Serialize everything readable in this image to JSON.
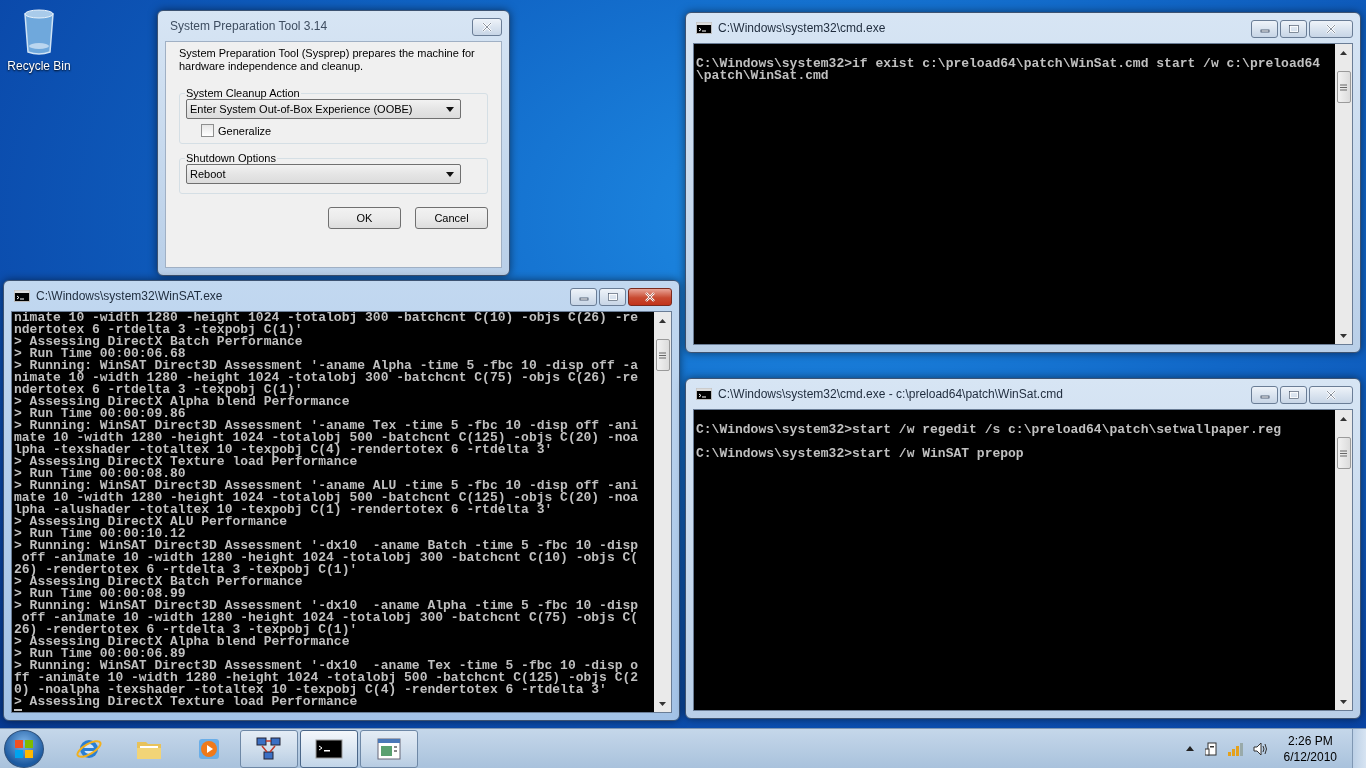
{
  "desktop": {
    "icons": [
      {
        "label": "Recycle Bin"
      }
    ]
  },
  "windows": [
    {
      "kind": "dialog",
      "title": "System Preparation Tool 3.14",
      "active": false,
      "description": "System Preparation Tool (Sysprep) prepares the machine for hardware independence and cleanup.",
      "groups": [
        {
          "label": "System Cleanup Action",
          "value": "Enter System Out-of-Box Experience (OOBE)",
          "checkbox": {
            "label": "Generalize",
            "checked": false
          }
        },
        {
          "label": "Shutdown Options",
          "value": "Reboot"
        }
      ],
      "buttons": [
        "OK",
        "Cancel"
      ]
    },
    {
      "kind": "console",
      "title": "C:\\Windows\\system32\\cmd.exe",
      "active": false,
      "cursor": false,
      "blocks": [
        [
          "C:\\Windows\\system32>if exist c:\\preload64\\patch\\WinSat.cmd start /w c:\\preload64",
          "\\patch\\WinSat.cmd"
        ]
      ]
    },
    {
      "kind": "console",
      "title": "C:\\Windows\\system32\\WinSAT.exe",
      "active": true,
      "cursor": true,
      "blocks": [
        [
          "nimate 10 -width 1280 -height 1024 -totalobj 300 -batchcnt C(10) -objs C(26) -re",
          "ndertotex 6 -rtdelta 3 -texpobj C(1)'",
          "> Assessing DirectX Batch Performance",
          "> Run Time 00:00:06.68",
          "> Running: WinSAT Direct3D Assessment '-aname Alpha -time 5 -fbc 10 -disp off -a",
          "nimate 10 -width 1280 -height 1024 -totalobj 300 -batchcnt C(75) -objs C(26) -re",
          "ndertotex 6 -rtdelta 3 -texpobj C(1)'",
          "> Assessing DirectX Alpha blend Performance",
          "> Run Time 00:00:09.86",
          "> Running: WinSAT Direct3D Assessment '-aname Tex -time 5 -fbc 10 -disp off -ani",
          "mate 10 -width 1280 -height 1024 -totalobj 500 -batchcnt C(125) -objs C(20) -noa",
          "lpha -texshader -totaltex 10 -texpobj C(4) -rendertotex 6 -rtdelta 3'",
          "> Assessing DirectX Texture load Performance",
          "> Run Time 00:00:08.80",
          "> Running: WinSAT Direct3D Assessment '-aname ALU -time 5 -fbc 10 -disp off -ani",
          "mate 10 -width 1280 -height 1024 -totalobj 500 -batchcnt C(125) -objs C(20) -noa",
          "lpha -alushader -totaltex 10 -texpobj C(1) -rendertotex 6 -rtdelta 3'",
          "> Assessing DirectX ALU Performance",
          "> Run Time 00:00:10.12",
          "> Running: WinSAT Direct3D Assessment '-dx10  -aname Batch -time 5 -fbc 10 -disp",
          " off -animate 10 -width 1280 -height 1024 -totalobj 300 -batchcnt C(10) -objs C(",
          "26) -rendertotex 6 -rtdelta 3 -texpobj C(1)'",
          "> Assessing DirectX Batch Performance",
          "> Run Time 00:00:08.99",
          "> Running: WinSAT Direct3D Assessment '-dx10  -aname Alpha -time 5 -fbc 10 -disp",
          " off -animate 10 -width 1280 -height 1024 -totalobj 300 -batchcnt C(75) -objs C(",
          "26) -rendertotex 6 -rtdelta 3 -texpobj C(1)'",
          "> Assessing DirectX Alpha blend Performance",
          "> Run Time 00:00:06.89",
          "> Running: WinSAT Direct3D Assessment '-dx10  -aname Tex -time 5 -fbc 10 -disp o",
          "ff -animate 10 -width 1280 -height 1024 -totalobj 500 -batchcnt C(125) -objs C(2",
          "0) -noalpha -texshader -totaltex 10 -texpobj C(4) -rendertotex 6 -rtdelta 3'",
          "> Assessing DirectX Texture load Performance"
        ]
      ]
    },
    {
      "kind": "console",
      "title": "C:\\Windows\\system32\\cmd.exe - c:\\preload64\\patch\\WinSat.cmd",
      "active": false,
      "cursor": false,
      "blocks": [
        [
          "C:\\Windows\\system32>start /w regedit /s c:\\preload64\\patch\\setwallpaper.reg"
        ],
        [
          "C:\\Windows\\system32>start /w WinSAT prepop"
        ]
      ]
    }
  ],
  "taskbar": {
    "items": [
      {
        "kind": "browser",
        "running": false,
        "active": false
      },
      {
        "kind": "folder",
        "running": false,
        "active": false
      },
      {
        "kind": "media",
        "running": false,
        "active": false
      },
      {
        "kind": "network",
        "running": true,
        "active": false
      },
      {
        "kind": "console",
        "running": true,
        "active": true
      },
      {
        "kind": "dialog",
        "running": true,
        "active": false
      }
    ],
    "clock": {
      "time": "2:26 PM",
      "date": "6/12/2010"
    }
  }
}
